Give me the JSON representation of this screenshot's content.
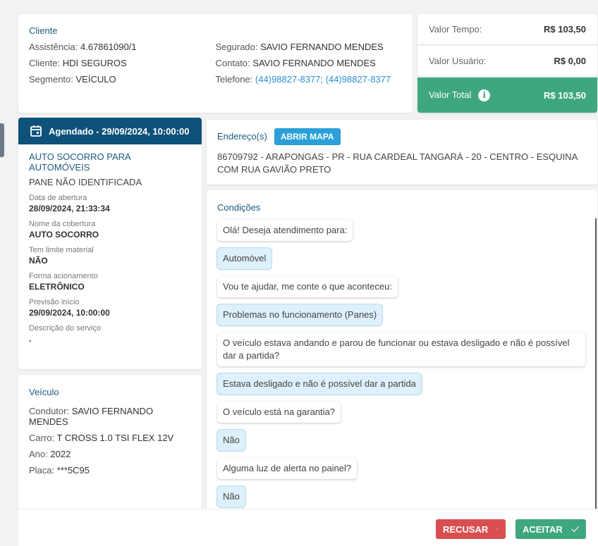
{
  "cliente": {
    "title": "Cliente",
    "assistencia_label": "Assistência:",
    "assistencia": "4.67861090/1",
    "cliente_label": "Cliente:",
    "cliente": "HDI SEGUROS",
    "segmento_label": "Segmento:",
    "segmento": "VEÍCULO",
    "segurado_label": "Segurado:",
    "segurado": "SAVIO FERNANDO MENDES",
    "contato_label": "Contato:",
    "contato": "SAVIO FERNANDO MENDES",
    "telefone_label": "Telefone:",
    "telefone": "(44)98827-8377; (44)98827-8377"
  },
  "valores": {
    "tempo_label": "Valor Tempo:",
    "tempo": "R$ 103,50",
    "usuario_label": "Valor Usuário:",
    "usuario": "R$ 0,00",
    "total_label": "Valor Total",
    "total": "R$ 103,50",
    "accent": "#3fa77e"
  },
  "servico": {
    "header": "Agendado - 29/09/2024, 10:00:00",
    "tipo": "AUTO SOCORRO PARA AUTOMÓVEIS",
    "problema": "PANE NÃO IDENTIFICADA",
    "fields": [
      {
        "label": "Data de abertura",
        "value": "28/09/2024, 21:33:34"
      },
      {
        "label": "Nome da cobertura",
        "value": "AUTO SOCORRO"
      },
      {
        "label": "Tem limite material",
        "value": "NÃO"
      },
      {
        "label": "Forma acionamento",
        "value": "ELETRÔNICO"
      },
      {
        "label": "Previsão início",
        "value": "29/09/2024, 10:00:00"
      },
      {
        "label": "Descrição do serviço",
        "value": "."
      }
    ]
  },
  "veiculo": {
    "title": "Veículo",
    "condutor_label": "Condutor:",
    "condutor": "SAVIO FERNANDO MENDES",
    "carro_label": "Carro:",
    "carro": "T CROSS 1.0 TSI FLEX 12V",
    "ano_label": "Ano:",
    "ano": "2022",
    "placa_label": "Placa:",
    "placa": "***5C95"
  },
  "endereco": {
    "title": "Endereço(s)",
    "map_button": "ABRIR MAPA",
    "text": "86709792 - ARAPONGAS - PR - RUA CARDEAL TANGARÁ - 20 - CENTRO - ESQUINA COM RUA GAVIÃO PRETO"
  },
  "condicoes": {
    "title": "Condições",
    "messages": [
      {
        "text": "Olá! Deseja atendimento para:",
        "answer": false
      },
      {
        "text": "Automóvel",
        "answer": true
      },
      {
        "text": "Vou te ajudar, me conte o que aconteceu:",
        "answer": false
      },
      {
        "text": "Problemas no funcionamento (Panes)",
        "answer": true
      },
      {
        "text": "O veículo estava andando e parou de funcionar ou estava desligado e não é possível dar a partida?",
        "answer": false
      },
      {
        "text": "Estava desligado e não é possível dar a partida",
        "answer": true
      },
      {
        "text": "O veículo está na garantia?",
        "answer": false
      },
      {
        "text": "Não",
        "answer": true
      },
      {
        "text": "Alguma luz de alerta no painel?",
        "answer": false
      },
      {
        "text": "Não",
        "answer": true
      }
    ]
  },
  "actions": {
    "recusar": "RECUSAR",
    "aceitar": "ACEITAR"
  }
}
